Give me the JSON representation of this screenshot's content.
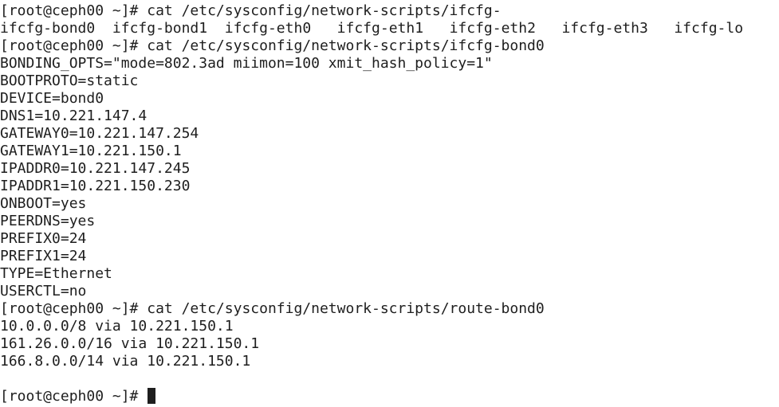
{
  "terminal": {
    "lines": [
      {
        "kind": "cmd",
        "prompt": "[root@ceph00 ~]# ",
        "command": "cat /etc/sysconfig/network-scripts/ifcfg-"
      },
      {
        "kind": "completions",
        "items": [
          "ifcfg-bond0  ",
          "ifcfg-bond1  ",
          "ifcfg-eth0   ",
          "ifcfg-eth1   ",
          "ifcfg-eth2   ",
          "ifcfg-eth3   ",
          "ifcfg-lo"
        ]
      },
      {
        "kind": "cmd",
        "prompt": "[root@ceph00 ~]# ",
        "command": "cat /etc/sysconfig/network-scripts/ifcfg-bond0"
      },
      {
        "kind": "out",
        "text": "BONDING_OPTS=\"mode=802.3ad miimon=100 xmit_hash_policy=1\""
      },
      {
        "kind": "out",
        "text": "BOOTPROTO=static"
      },
      {
        "kind": "out",
        "text": "DEVICE=bond0"
      },
      {
        "kind": "out",
        "text": "DNS1=10.221.147.4"
      },
      {
        "kind": "out",
        "text": "GATEWAY0=10.221.147.254"
      },
      {
        "kind": "out",
        "text": "GATEWAY1=10.221.150.1"
      },
      {
        "kind": "out",
        "text": "IPADDR0=10.221.147.245"
      },
      {
        "kind": "out",
        "text": "IPADDR1=10.221.150.230"
      },
      {
        "kind": "out",
        "text": "ONBOOT=yes"
      },
      {
        "kind": "out",
        "text": "PEERDNS=yes"
      },
      {
        "kind": "out",
        "text": "PREFIX0=24"
      },
      {
        "kind": "out",
        "text": "PREFIX1=24"
      },
      {
        "kind": "out",
        "text": "TYPE=Ethernet"
      },
      {
        "kind": "out",
        "text": "USERCTL=no"
      },
      {
        "kind": "cmd",
        "prompt": "[root@ceph00 ~]# ",
        "command": "cat /etc/sysconfig/network-scripts/route-bond0"
      },
      {
        "kind": "out",
        "text": "10.0.0.0/8 via 10.221.150.1"
      },
      {
        "kind": "out",
        "text": "161.26.0.0/16 via 10.221.150.1"
      },
      {
        "kind": "out",
        "text": "166.8.0.0/14 via 10.221.150.1"
      },
      {
        "kind": "out",
        "text": ""
      },
      {
        "kind": "prompt",
        "prompt": "[root@ceph00 ~]# ",
        "command": ""
      }
    ]
  },
  "colors": {
    "background": "#ffffff",
    "foreground": "#1e1e1e",
    "cursor": "#1e1e1e"
  }
}
